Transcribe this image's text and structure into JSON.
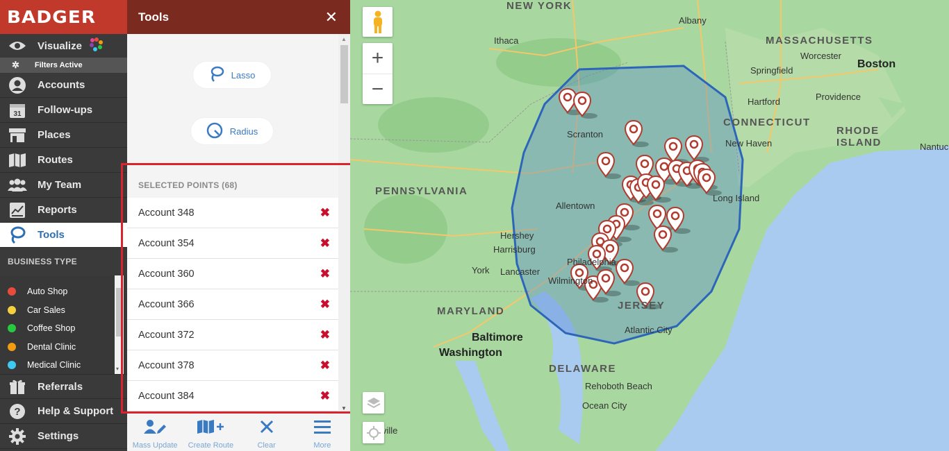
{
  "app": {
    "logo_text": "BADGER"
  },
  "nav": {
    "visualize": "Visualize",
    "filters_active": "Filters Active",
    "accounts": "Accounts",
    "followups": "Follow-ups",
    "followups_day": "31",
    "places": "Places",
    "routes": "Routes",
    "my_team": "My Team",
    "reports": "Reports",
    "tools": "Tools",
    "referrals": "Referrals",
    "help": "Help & Support",
    "settings": "Settings"
  },
  "business_type": {
    "header": "BUSINESS TYPE",
    "items": [
      {
        "label": "Auto Shop",
        "color": "#e74c3c"
      },
      {
        "label": "Car Sales",
        "color": "#f4d03f"
      },
      {
        "label": "Coffee Shop",
        "color": "#27c93f"
      },
      {
        "label": "Dental Clinic",
        "color": "#f39c12"
      },
      {
        "label": "Medical Clinic",
        "color": "#3ec9f0"
      }
    ]
  },
  "panel": {
    "title": "Tools",
    "close": "✕",
    "lasso_label": "Lasso",
    "radius_label": "Radius",
    "selected_header": "SELECTED POINTS (68)",
    "selected": [
      "Account 348",
      "Account 354",
      "Account 360",
      "Account 366",
      "Account 372",
      "Account 378",
      "Account 384"
    ]
  },
  "toolbar": {
    "mass_update": "Mass Update",
    "create_route": "Create Route",
    "clear": "Clear",
    "more": "More"
  },
  "map": {
    "labels": [
      {
        "text": "NEW YORK",
        "cls": "state"
      },
      {
        "text": "MASSACHUSETTS",
        "cls": "state"
      },
      {
        "text": "CONNECTICUT",
        "cls": "state"
      },
      {
        "text": "RHODE",
        "cls": "state"
      },
      {
        "text": "ISLAND",
        "cls": "state"
      },
      {
        "text": "PENNSYLVANIA",
        "cls": "state"
      },
      {
        "text": "MARYLAND",
        "cls": "state"
      },
      {
        "text": "DELAWARE",
        "cls": "state"
      },
      {
        "text": "JERSEY",
        "cls": "state"
      },
      {
        "text": "Albany",
        "cls": "city"
      },
      {
        "text": "Ithaca",
        "cls": "city"
      },
      {
        "text": "Worcester",
        "cls": "city"
      },
      {
        "text": "Boston",
        "cls": "big-city"
      },
      {
        "text": "Springfield",
        "cls": "city"
      },
      {
        "text": "Providence",
        "cls": "city"
      },
      {
        "text": "Hartford",
        "cls": "city"
      },
      {
        "text": "New Haven",
        "cls": "city"
      },
      {
        "text": "Nantucket",
        "cls": "city"
      },
      {
        "text": "Scranton",
        "cls": "city"
      },
      {
        "text": "Allentown",
        "cls": "city"
      },
      {
        "text": "Long Island",
        "cls": "city"
      },
      {
        "text": "Hershey",
        "cls": "city"
      },
      {
        "text": "Harrisburg",
        "cls": "city"
      },
      {
        "text": "York",
        "cls": "city"
      },
      {
        "text": "Lancaster",
        "cls": "city"
      },
      {
        "text": "Philadelphia",
        "cls": "city"
      },
      {
        "text": "Wilmington",
        "cls": "city"
      },
      {
        "text": "Baltimore",
        "cls": "big-city"
      },
      {
        "text": "Washington",
        "cls": "big-city"
      },
      {
        "text": "Atlantic City",
        "cls": "city"
      },
      {
        "text": "Rehoboth Beach",
        "cls": "city"
      },
      {
        "text": "Ocean City",
        "cls": "city"
      },
      {
        "text": "ville",
        "cls": "city"
      }
    ]
  },
  "colors": {
    "accent": "#2d6fb4",
    "brand": "#c0392b",
    "panel_header": "#7a2a1e",
    "remove": "#c8102e",
    "highlight": "#d9232d"
  }
}
